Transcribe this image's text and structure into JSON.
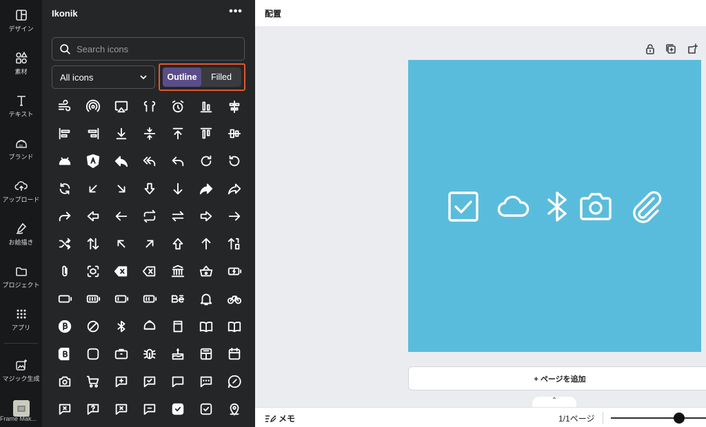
{
  "rail": {
    "items": [
      {
        "label": "デザイン",
        "icon": "layout-icon"
      },
      {
        "label": "素材",
        "icon": "shapes-icon"
      },
      {
        "label": "テキスト",
        "icon": "text-icon"
      },
      {
        "label": "ブランド",
        "icon": "brand-icon"
      },
      {
        "label": "アップロード",
        "icon": "cloud-upload-icon"
      },
      {
        "label": "お絵描き",
        "icon": "draw-icon"
      },
      {
        "label": "プロジェクト",
        "icon": "folder-icon"
      },
      {
        "label": "アプリ",
        "icon": "apps-grid-icon"
      },
      {
        "label": "マジック生成",
        "icon": "magic-media-icon"
      }
    ],
    "app_thumb_label": "Frame Mak..."
  },
  "panel": {
    "title": "Ikonik",
    "more": "•••",
    "search_placeholder": "Search icons",
    "filter_selected": "All icons",
    "style_toggle": {
      "outline": "Outline",
      "filled": "Filled",
      "selected": "Outline"
    }
  },
  "editor": {
    "title": "配置",
    "add_page": "+ ページを追加",
    "memo": "メモ",
    "page_count": "1/1ページ",
    "canvas_bg": "#5abcdc",
    "accent": "#5a4d89",
    "highlight": "#e5572a"
  }
}
